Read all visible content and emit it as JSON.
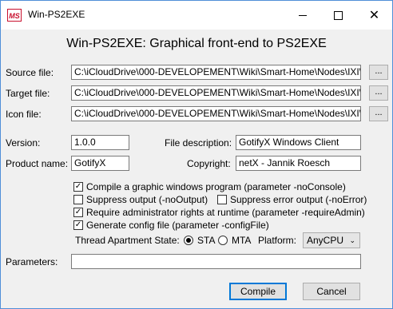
{
  "window": {
    "app_icon_text": "MS",
    "title": "Win-PS2EXE",
    "minimize_glyph": "",
    "maximize_glyph": "",
    "close_glyph": "✕"
  },
  "heading": "Win-PS2EXE: Graphical front-end to PS2EXE",
  "files": {
    "source_label": "Source file:",
    "source_value": "C:\\iCloudDrive\\000-DEVELOPEMENT\\Wiki\\Smart-Home\\Nodes\\IXI\\gotify\\",
    "target_label": "Target file:",
    "target_value": "C:\\iCloudDrive\\000-DEVELOPEMENT\\Wiki\\Smart-Home\\Nodes\\IXI\\gotify\\",
    "icon_label": "Icon file:",
    "icon_value": "C:\\iCloudDrive\\000-DEVELOPEMENT\\Wiki\\Smart-Home\\Nodes\\IXI\\gotify\\",
    "browse_label": "..."
  },
  "meta": {
    "version_label": "Version:",
    "version_value": "1.0.0",
    "description_label": "File description:",
    "description_value": "GotifyX Windows Client",
    "product_label": "Product name:",
    "product_value": "GotifyX",
    "copyright_label": "Copyright:",
    "copyright_value": "netX - Jannik Roesch"
  },
  "options": {
    "compile_gui": {
      "label": "Compile a graphic windows program (parameter -noConsole)",
      "checked": true
    },
    "suppress_output": {
      "label": "Suppress output (-noOutput)",
      "checked": false
    },
    "suppress_error": {
      "label": "Suppress error output (-noError)",
      "checked": false
    },
    "require_admin": {
      "label": "Require administrator rights at runtime (parameter -requireAdmin)",
      "checked": true
    },
    "generate_config": {
      "label": "Generate config file (parameter -configFile)",
      "checked": true
    },
    "check_glyph": "✓"
  },
  "threading": {
    "label": "Thread Apartment State:",
    "sta_label": "STA",
    "mta_label": "MTA",
    "selected": "STA",
    "platform_label": "Platform:",
    "platform_value": "AnyCPU",
    "chevron": "⌄"
  },
  "parameters": {
    "label": "Parameters:",
    "value": ""
  },
  "actions": {
    "compile_label": "Compile",
    "cancel_label": "Cancel"
  }
}
